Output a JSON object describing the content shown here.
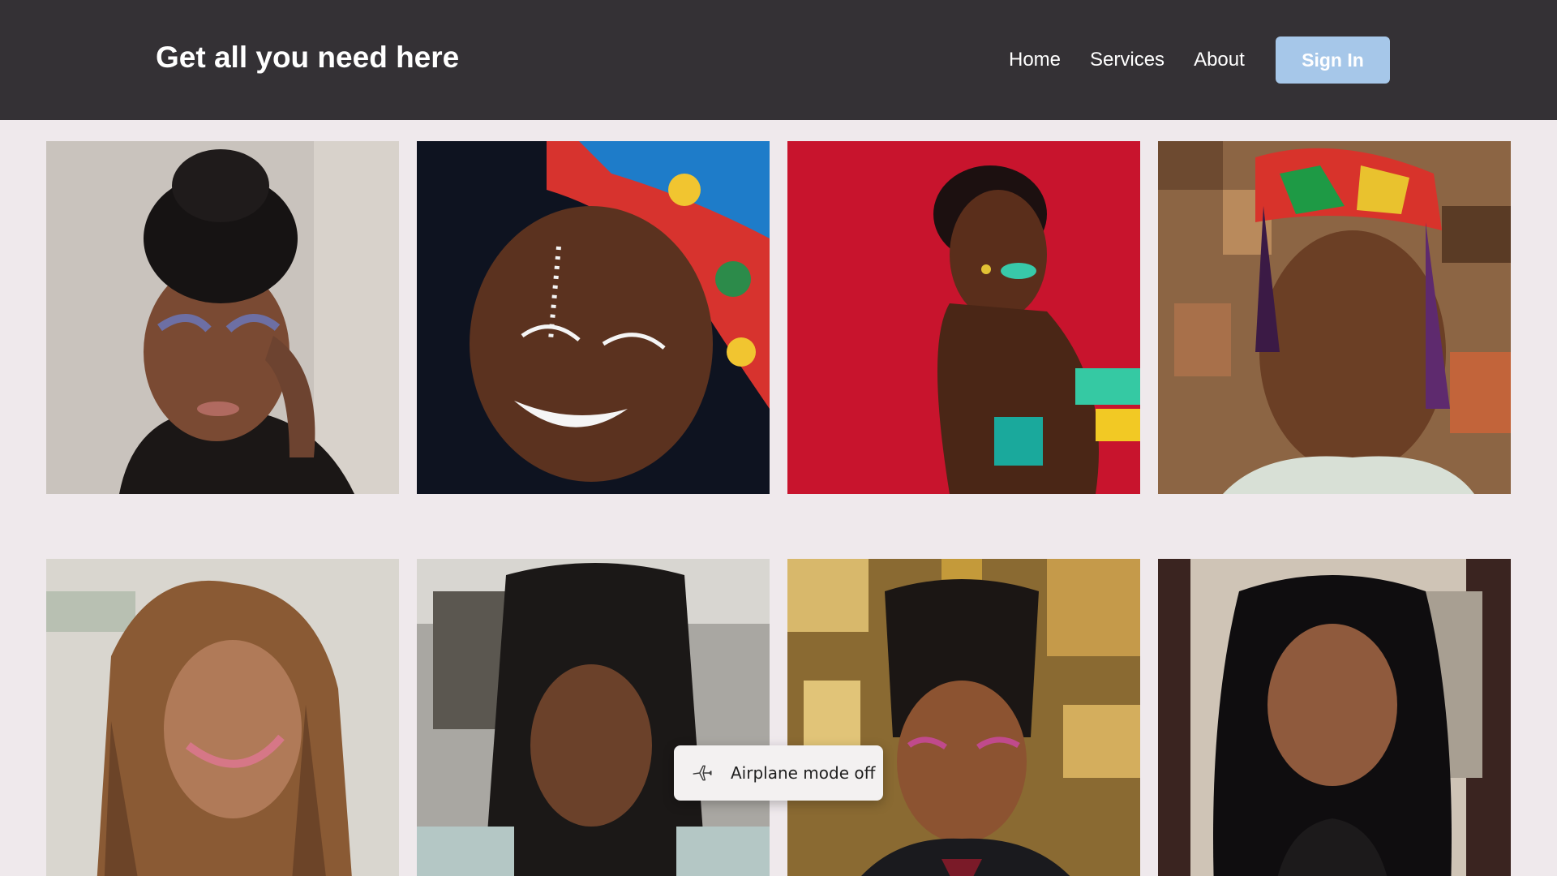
{
  "header": {
    "title": "Get all you need here",
    "nav": [
      "Home",
      "Services",
      "About"
    ],
    "signin_label": "Sign In"
  },
  "gallery": {
    "images": [
      {
        "name": "photo-woman-black-headwrap"
      },
      {
        "name": "photo-girl-colorful-headwrap"
      },
      {
        "name": "photo-woman-red-background"
      },
      {
        "name": "photo-woman-kente-headwrap"
      },
      {
        "name": "photo-woman-curly-braids"
      },
      {
        "name": "photo-woman-knotless-braids"
      },
      {
        "name": "photo-woman-braided-ponytail"
      },
      {
        "name": "photo-woman-wavy-hair"
      }
    ]
  },
  "toast": {
    "icon": "airplane-icon",
    "message": "Airplane mode off"
  },
  "colors": {
    "header_bg": "#343135",
    "page_bg": "#efe9ec",
    "button_bg": "#a6c7e9"
  }
}
